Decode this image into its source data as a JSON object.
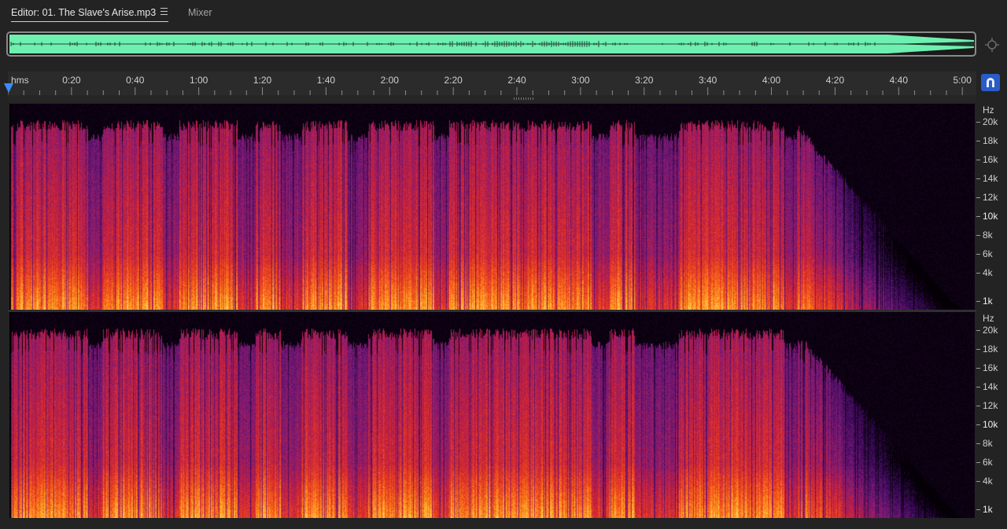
{
  "tabs": {
    "editor_label": "Editor: 01. The Slave's Arise.mp3",
    "mixer_label": "Mixer"
  },
  "icons": {
    "menu": "hamburger-menu-icon",
    "zoom": "zoom-navigator-icon",
    "snap": "magnet-snap-icon",
    "playhead": "playhead-marker-icon"
  },
  "ruler": {
    "unit": "hms",
    "ticks": [
      "0:20",
      "0:40",
      "1:00",
      "1:20",
      "1:40",
      "2:00",
      "2:20",
      "2:40",
      "3:00",
      "3:20",
      "3:40",
      "4:00",
      "4:20",
      "4:40",
      "5:00"
    ],
    "duration_seconds": 304
  },
  "frequency_ruler": {
    "unit": "Hz",
    "labels": [
      "20k",
      "18k",
      "16k",
      "14k",
      "12k",
      "10k",
      "8k",
      "6k",
      "4k",
      "1k"
    ]
  },
  "colors": {
    "overview_wave": "#6ef0b0",
    "accent_blue": "#2a5cc8",
    "spectrum_palette": [
      "#040005",
      "#3a0a5a",
      "#7a1a78",
      "#c8203c",
      "#f04a1a",
      "#ffa020",
      "#fff07a"
    ]
  }
}
